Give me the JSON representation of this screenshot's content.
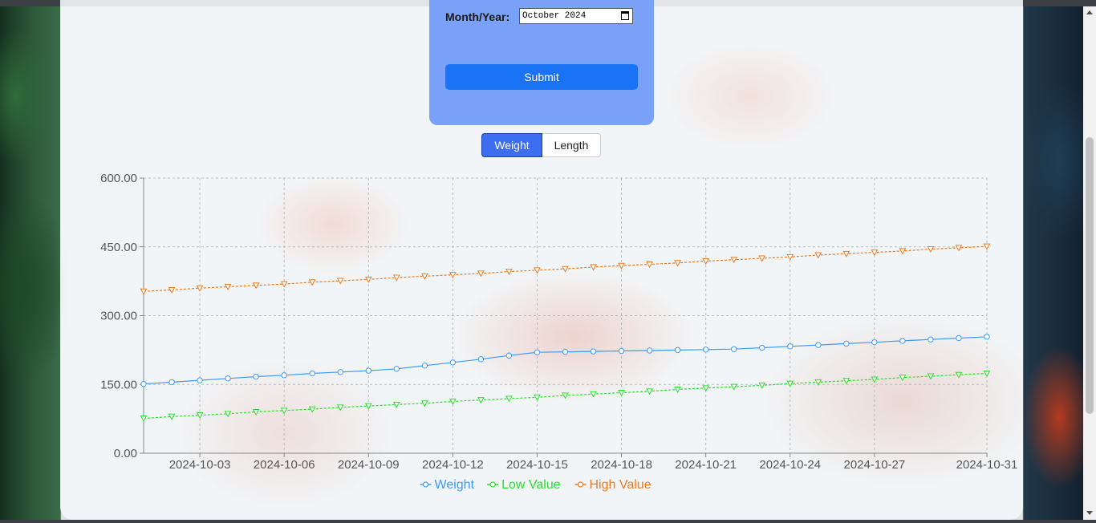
{
  "form": {
    "month_label": "Month/Year:",
    "month_value": "October 2024",
    "submit_label": "Submit"
  },
  "toggle": {
    "weight_label": "Weight",
    "length_label": "Length",
    "selected": "Weight"
  },
  "colors": {
    "card": "#79a1f7",
    "submit": "#1a73f5",
    "weight_series": "#3d9bf5",
    "low_series": "#27e027",
    "high_series": "#f07a1e"
  },
  "chart_data": {
    "type": "line",
    "xlabel": "",
    "ylabel": "",
    "ylim": [
      0,
      600
    ],
    "yticks": [
      "0.00",
      "150.00",
      "300.00",
      "450.00",
      "600.00"
    ],
    "x_tick_labels": [
      "2024-10-03",
      "2024-10-06",
      "2024-10-09",
      "2024-10-12",
      "2024-10-15",
      "2024-10-18",
      "2024-10-21",
      "2024-10-24",
      "2024-10-27",
      "2024-10-31"
    ],
    "x": [
      "2024-10-01",
      "2024-10-02",
      "2024-10-03",
      "2024-10-04",
      "2024-10-05",
      "2024-10-06",
      "2024-10-07",
      "2024-10-08",
      "2024-10-09",
      "2024-10-10",
      "2024-10-11",
      "2024-10-12",
      "2024-10-13",
      "2024-10-14",
      "2024-10-15",
      "2024-10-16",
      "2024-10-17",
      "2024-10-18",
      "2024-10-19",
      "2024-10-20",
      "2024-10-21",
      "2024-10-22",
      "2024-10-23",
      "2024-10-24",
      "2024-10-25",
      "2024-10-26",
      "2024-10-27",
      "2024-10-28",
      "2024-10-29",
      "2024-10-30",
      "2024-10-31"
    ],
    "grid": true,
    "legend_position": "bottom-center",
    "series": [
      {
        "name": "Weight",
        "color": "#3d9bf5",
        "dashed": false,
        "values": [
          151,
          155,
          159,
          163,
          167,
          170,
          174,
          177,
          180,
          184,
          191,
          198,
          205,
          213,
          220,
          221,
          222,
          223,
          224,
          225,
          226,
          227,
          230,
          233,
          236,
          239,
          242,
          245,
          248,
          251,
          254
        ]
      },
      {
        "name": "Low Value",
        "color": "#27e027",
        "dashed": true,
        "values": [
          76,
          80,
          83,
          86,
          90,
          93,
          96,
          100,
          103,
          106,
          109,
          113,
          116,
          119,
          122,
          126,
          129,
          132,
          135,
          139,
          142,
          145,
          148,
          152,
          155,
          158,
          161,
          165,
          168,
          171,
          174
        ]
      },
      {
        "name": "High Value",
        "color": "#f07a1e",
        "dashed": true,
        "values": [
          353,
          356,
          360,
          363,
          366,
          369,
          373,
          376,
          379,
          383,
          386,
          389,
          392,
          396,
          399,
          402,
          406,
          409,
          412,
          415,
          419,
          422,
          425,
          428,
          432,
          435,
          438,
          441,
          445,
          448,
          451
        ]
      }
    ]
  }
}
